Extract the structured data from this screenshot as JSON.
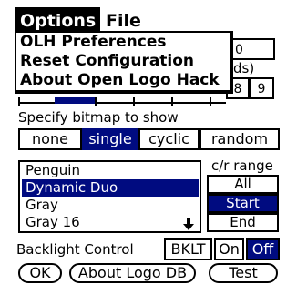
{
  "menubar": {
    "options": "Options",
    "file": "File"
  },
  "dropdown": {
    "items": [
      "OLH Preferences",
      "Reset Configuration",
      "About Open Logo Hack"
    ]
  },
  "background": {
    "partial_1": "0",
    "partial_2": "ds)",
    "partial_3": "8",
    "partial_4": "9"
  },
  "bitmap": {
    "label": "Specify bitmap to show",
    "options": [
      "none",
      "single",
      "cyclic",
      "random"
    ],
    "selected": "single"
  },
  "list": {
    "items": [
      "Penguin",
      "Dynamic Duo",
      "Gray",
      "Gray 16"
    ],
    "selected": "Dynamic Duo",
    "scroll_down_icon": "arrow-down-icon"
  },
  "range": {
    "label": "c/r range",
    "options": [
      "All",
      "Start",
      "End"
    ],
    "selected": "Start"
  },
  "backlight": {
    "label": "Backlight Control",
    "options": [
      "BKLT",
      "On",
      "Off"
    ],
    "selected": "Off"
  },
  "buttons": {
    "ok": "OK",
    "about": "About Logo DB",
    "test": "Test"
  },
  "colors": {
    "selection": "#000b80",
    "text": "#000000",
    "background": "#ffffff"
  }
}
